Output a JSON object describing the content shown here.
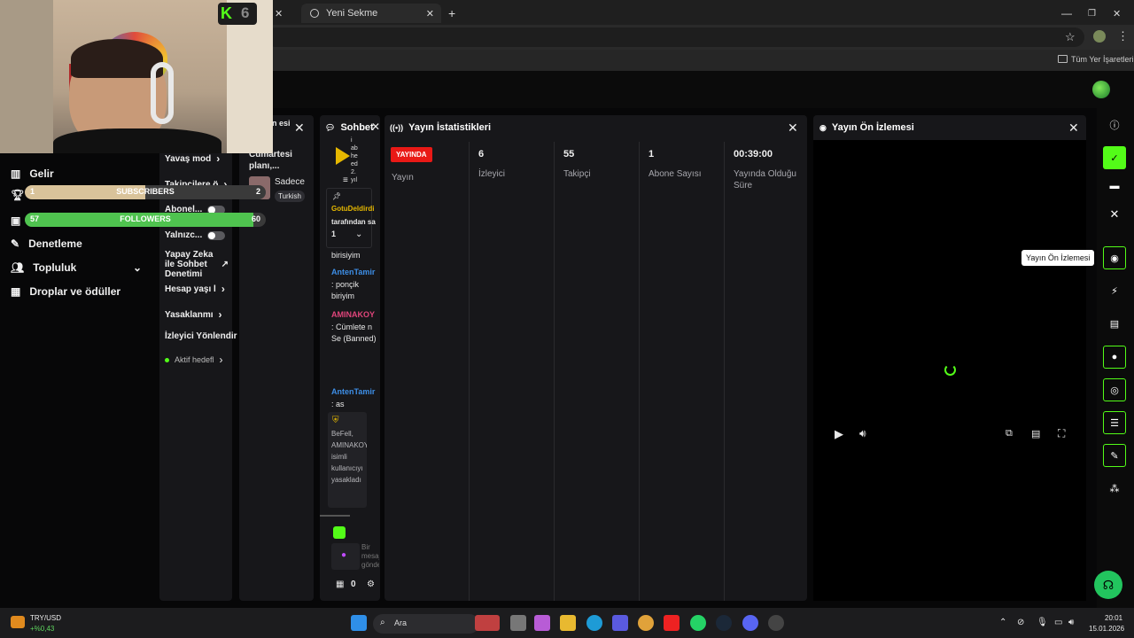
{
  "browser": {
    "tab_label": "Yeni Sekme",
    "bookmarks_label": "Tüm Yer İşaretleri"
  },
  "webcam": {
    "badge": "6"
  },
  "goals": {
    "subscribers": {
      "current": "1",
      "label": "SUBSCRIBERS",
      "target": "2",
      "progress": 0.5
    },
    "followers": {
      "current": "57",
      "label": "FOLLOWERS",
      "target": "60",
      "progress": 0.95
    }
  },
  "sidebar": {
    "items": [
      {
        "label": "Gelir",
        "icon": "chart-icon"
      },
      {
        "label": "Denetleme",
        "icon": "wrench-icon"
      },
      {
        "label": "Topluluk",
        "icon": "people-icon"
      },
      {
        "label": "Droplar ve ödüller",
        "icon": "gift-icon"
      }
    ]
  },
  "mod_panel": {
    "rows": [
      {
        "label": "Yavaş mod"
      },
      {
        "label": "Takipçilere ö"
      },
      {
        "label": "Abonel..."
      },
      {
        "label": "Yalnızc..."
      },
      {
        "label": "Yapay Zeka ile Sohbet Denetimi"
      },
      {
        "label": "Hesap yaşı l"
      },
      {
        "label": "Yasaklanmı"
      },
      {
        "label": "İzleyici Yönlendir"
      },
      {
        "label": "Aktif hedefl"
      }
    ]
  },
  "schedule_panel": {
    "title": "n esi",
    "item_title": "Cumartesi planı,...",
    "item_sub": "Sadece",
    "item_tag": "Turkish"
  },
  "chat": {
    "title": "Sohbet",
    "pinned_lines": [
      "i",
      "ab",
      "he",
      "ed",
      "2.",
      "yıl"
    ],
    "pinned_by": "GotuDeldirdi",
    "pinned_meta": "tarafından sa",
    "pinned_count": "1",
    "messages": [
      {
        "text": "birisiyim"
      },
      {
        "user": "AntenTamir",
        "text": ": ponçik biriyim"
      },
      {
        "user": "AMINAKOY",
        "text": ": Cümlete n Se (Banned)"
      },
      {
        "user": "AntenTamir",
        "text": ": as"
      }
    ],
    "mod_notice": "BeFell, AMINAKOYU isimli kullanıcıyı yasakladı",
    "input_placeholder": "Bir mesaj gönder",
    "points": "0"
  },
  "stats": {
    "title": "Yayın İstatistikleri",
    "live_badge": "YAYINDA",
    "live_label": "Yayın",
    "viewers": {
      "value": "6",
      "label": "İzleyici"
    },
    "followers": {
      "value": "55",
      "label": "Takipçi"
    },
    "subs": {
      "value": "1",
      "label": "Abone Sayısı"
    },
    "uptime": {
      "value": "00:39:00",
      "label": "Yayında Olduğu Süre"
    }
  },
  "preview": {
    "title": "Yayın Ön İzlemesi",
    "tooltip": "Yayın Ön İzlemesi"
  },
  "taskbar": {
    "ticker": "TRY/USD",
    "ticker_change": "+%0,43",
    "search": "Ara",
    "time": "20:01",
    "date": "15.01.2026"
  },
  "colors": {
    "accent": "#53fc18",
    "live": "#e91916",
    "panel": "#17171a"
  }
}
